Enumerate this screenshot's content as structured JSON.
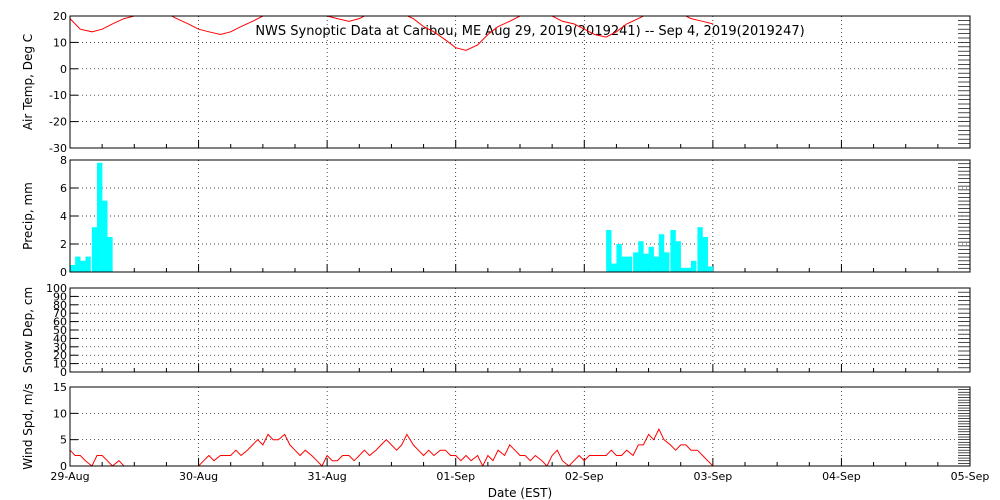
{
  "chart_data": {
    "title": "NWS Synoptic Data at Caribou, ME   Aug 29, 2019(2019241) -- Sep  4, 2019(2019247)",
    "xlabel": "Date (EST)",
    "x_tick_labels": [
      "29-Aug",
      "30-Aug",
      "31-Aug",
      "01-Sep",
      "02-Sep",
      "03-Sep",
      "04-Sep",
      "05-Sep"
    ],
    "x_unit": "days since 29-Aug 00:00 EST",
    "x_range": [
      0,
      7
    ],
    "grid": "dotted",
    "colors": {
      "temp": "#ff0000",
      "precip": "#00ffff",
      "wind": "#ff0000",
      "axis": "#000000"
    },
    "panels": [
      {
        "id": "airtemp",
        "type": "line",
        "ylabel": "Air Temp, Deg C",
        "ylim": [
          -30,
          20
        ],
        "yticks": [
          -30,
          -20,
          -10,
          0,
          10,
          20
        ],
        "x": [
          0.0,
          0.08,
          0.17,
          0.25,
          0.33,
          0.42,
          0.5,
          0.58,
          0.67,
          0.75,
          0.83,
          0.92,
          1.0,
          1.08,
          1.17,
          1.25,
          1.33,
          1.42,
          1.5,
          1.58,
          1.67,
          1.75,
          1.83,
          1.92,
          2.0,
          2.08,
          2.17,
          2.25,
          2.33,
          2.42,
          2.5,
          2.58,
          2.67,
          2.75,
          2.83,
          2.92,
          3.0,
          3.08,
          3.17,
          3.25,
          3.33,
          3.42,
          3.5,
          3.58,
          3.67,
          3.75,
          3.83,
          3.92,
          4.0,
          4.08,
          4.17,
          4.25,
          4.33,
          4.42,
          4.5,
          4.58,
          4.67,
          4.75,
          4.83,
          4.92,
          5.0
        ],
        "y": [
          19,
          15,
          14,
          15,
          17,
          19,
          20,
          21,
          21,
          21,
          19,
          17,
          15,
          14,
          13,
          14,
          16,
          18,
          20,
          22,
          24,
          25,
          24,
          22,
          20,
          19,
          18,
          19,
          21,
          22,
          22,
          21,
          19,
          16,
          14,
          11,
          8,
          7,
          9,
          13,
          16,
          18,
          20,
          21,
          21,
          20,
          18,
          17,
          15,
          13,
          12,
          14,
          17,
          19,
          21,
          22,
          22,
          21,
          19,
          18,
          17
        ]
      },
      {
        "id": "precip",
        "type": "bar",
        "ylabel": "Precip, mm",
        "ylim": [
          0,
          8
        ],
        "yticks": [
          0,
          2,
          4,
          6,
          8
        ],
        "bar_width": 0.041667,
        "x": [
          0.0,
          0.04,
          0.08,
          0.12,
          0.17,
          0.21,
          0.25,
          0.29,
          4.17,
          4.21,
          4.25,
          4.29,
          4.33,
          4.38,
          4.42,
          4.46,
          4.5,
          4.54,
          4.58,
          4.62,
          4.67,
          4.71,
          4.75,
          4.79,
          4.83,
          4.88,
          4.92,
          4.96
        ],
        "y": [
          0.5,
          1.1,
          0.8,
          1.1,
          3.2,
          7.8,
          5.1,
          2.5,
          3.0,
          0.6,
          2.0,
          1.1,
          1.1,
          1.4,
          2.2,
          1.3,
          1.8,
          1.1,
          2.7,
          1.4,
          3.0,
          2.2,
          0.3,
          0.3,
          0.8,
          3.2,
          2.5,
          0.4
        ]
      },
      {
        "id": "snowdepth",
        "type": "line",
        "ylabel": "Snow Dep, cm",
        "ylim": [
          0,
          100
        ],
        "yticks": [
          0,
          10,
          20,
          30,
          40,
          50,
          60,
          70,
          80,
          90,
          100
        ],
        "x": [],
        "y": []
      },
      {
        "id": "windspd",
        "type": "line",
        "ylabel": "Wind Spd, m/s",
        "ylim": [
          0,
          15
        ],
        "yticks": [
          0,
          5,
          10,
          15
        ],
        "x": [
          0.0,
          0.04,
          0.08,
          0.12,
          0.17,
          0.21,
          0.25,
          0.29,
          0.33,
          0.38,
          0.42,
          0.46,
          0.5,
          0.54,
          0.58,
          0.62,
          0.67,
          0.71,
          0.75,
          0.79,
          0.83,
          0.88,
          0.92,
          0.96,
          1.0,
          1.04,
          1.08,
          1.12,
          1.17,
          1.21,
          1.25,
          1.29,
          1.33,
          1.38,
          1.42,
          1.46,
          1.5,
          1.54,
          1.58,
          1.62,
          1.67,
          1.71,
          1.75,
          1.79,
          1.83,
          1.88,
          1.92,
          1.96,
          2.0,
          2.04,
          2.08,
          2.12,
          2.17,
          2.21,
          2.25,
          2.29,
          2.33,
          2.38,
          2.42,
          2.46,
          2.5,
          2.54,
          2.58,
          2.62,
          2.67,
          2.71,
          2.75,
          2.79,
          2.83,
          2.88,
          2.92,
          2.96,
          3.0,
          3.04,
          3.08,
          3.12,
          3.17,
          3.21,
          3.25,
          3.29,
          3.33,
          3.38,
          3.42,
          3.46,
          3.5,
          3.54,
          3.58,
          3.62,
          3.67,
          3.71,
          3.75,
          3.79,
          3.83,
          3.88,
          3.92,
          3.96,
          4.0,
          4.04,
          4.08,
          4.12,
          4.17,
          4.21,
          4.25,
          4.29,
          4.33,
          4.38,
          4.42,
          4.46,
          4.5,
          4.54,
          4.58,
          4.62,
          4.67,
          4.71,
          4.75,
          4.79,
          4.83,
          4.88,
          4.92,
          4.96,
          5.0
        ],
        "y": [
          3,
          2,
          2,
          1,
          0,
          2,
          2,
          1,
          0,
          1,
          0,
          0,
          0,
          0,
          0,
          0,
          0,
          0,
          0,
          0,
          0,
          0,
          0,
          0,
          0,
          1,
          2,
          1,
          2,
          2,
          2,
          3,
          2,
          3,
          4,
          5,
          4,
          6,
          5,
          5,
          6,
          4,
          3,
          2,
          3,
          2,
          1,
          0,
          2,
          1,
          1,
          2,
          2,
          1,
          2,
          3,
          2,
          3,
          4,
          5,
          4,
          3,
          4,
          6,
          4,
          3,
          2,
          3,
          2,
          3,
          3,
          2,
          2,
          1,
          2,
          1,
          2,
          0,
          2,
          1,
          3,
          2,
          4,
          3,
          2,
          2,
          1,
          2,
          1,
          0,
          2,
          3,
          1,
          0,
          1,
          2,
          1,
          2,
          2,
          2,
          2,
          3,
          2,
          2,
          3,
          2,
          4,
          4,
          6,
          5,
          7,
          5,
          4,
          3,
          4,
          4,
          3,
          3,
          2,
          1,
          0,
          0,
          1
        ]
      }
    ]
  }
}
